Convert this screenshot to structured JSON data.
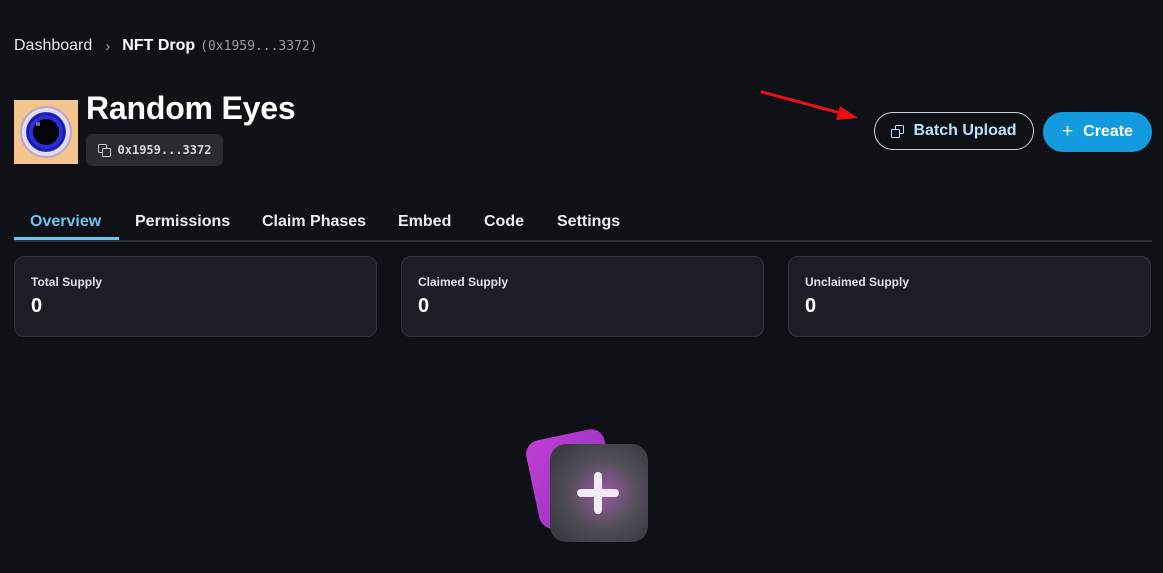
{
  "breadcrumb": {
    "root": "Dashboard",
    "separator": "›",
    "current": "NFT Drop",
    "address": "(0x1959...3372)"
  },
  "contract": {
    "name": "Random Eyes",
    "address": "0x1959...3372",
    "avatar_icon": "pixel-eye-icon"
  },
  "actions": {
    "batch_upload": "Batch Upload",
    "create": "Create"
  },
  "tabs": [
    {
      "label": "Overview",
      "active": true
    },
    {
      "label": "Permissions",
      "active": false
    },
    {
      "label": "Claim Phases",
      "active": false
    },
    {
      "label": "Embed",
      "active": false
    },
    {
      "label": "Code",
      "active": false
    },
    {
      "label": "Settings",
      "active": false
    }
  ],
  "stats": [
    {
      "label": "Total Supply",
      "value": "0"
    },
    {
      "label": "Claimed Supply",
      "value": "0"
    },
    {
      "label": "Unclaimed Supply",
      "value": "0"
    }
  ],
  "colors": {
    "background": "#101116",
    "accent": "#139bdf",
    "tab_active": "#6cc4f2",
    "annotation_arrow": "#e81010"
  }
}
